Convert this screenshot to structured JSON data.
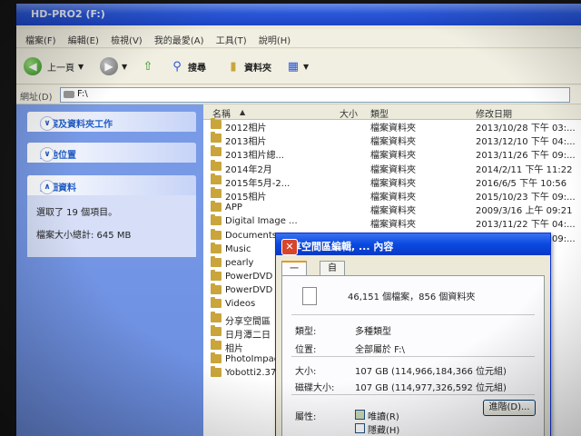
{
  "window": {
    "title": "HD-PRO2 (F:)"
  },
  "menu": [
    "檔案(F)",
    "編輯(E)",
    "檢視(V)",
    "我的最愛(A)",
    "工具(T)",
    "說明(H)"
  ],
  "toolbar": {
    "back": "上一頁",
    "search": "搜尋",
    "folders": "資料夾"
  },
  "address": {
    "label": "網址(D)",
    "value": "F:\\"
  },
  "left_panel": {
    "tasks_title": "檔案及資料夾工作",
    "places_title": "其他位置",
    "details_title": "詳細資料",
    "details_line1": "選取了 19 個項目。",
    "details_line2": "檔案大小總計: 645 MB"
  },
  "columns": {
    "name": "名稱",
    "size": "大小",
    "type": "類型",
    "date": "修改日期"
  },
  "files": [
    {
      "name": "2012相片",
      "type": "檔案資料夾",
      "date": "2013/10/28 下午 03:..."
    },
    {
      "name": "2013相片",
      "type": "檔案資料夾",
      "date": "2013/12/10 下午 04:..."
    },
    {
      "name": "2013相片總...",
      "type": "檔案資料夾",
      "date": "2013/11/26 下午 09:..."
    },
    {
      "name": "2014年2月",
      "type": "檔案資料夾",
      "date": "2014/2/11 下午 11:22"
    },
    {
      "name": "2015年5月-2...",
      "type": "檔案資料夾",
      "date": "2016/6/5 下午 10:56"
    },
    {
      "name": "2015相片",
      "type": "檔案資料夾",
      "date": "2015/10/23 下午 09:..."
    },
    {
      "name": "APP",
      "type": "檔案資料夾",
      "date": "2009/3/16 上午 09:21"
    },
    {
      "name": "Digital Image ...",
      "type": "檔案資料夾",
      "date": "2013/11/22 下午 04:..."
    },
    {
      "name": "Documents",
      "type": "檔案資料夾",
      "date": "2015/10/23 下午 09:..."
    },
    {
      "name": "Music",
      "type": "",
      "date": ""
    },
    {
      "name": "pearly",
      "type": "",
      "date": ""
    },
    {
      "name": "PowerDVD 8",
      "type": "",
      "date": ""
    },
    {
      "name": "PowerDVD 1",
      "type": "",
      "date": ""
    },
    {
      "name": "Videos",
      "type": "",
      "date": ""
    },
    {
      "name": "分享空間區",
      "type": "",
      "date": ""
    },
    {
      "name": "日月潭二日",
      "type": "",
      "date": ""
    },
    {
      "name": "相片",
      "type": "",
      "date": ""
    },
    {
      "name": "PhotoImpact",
      "type": "",
      "date": ""
    },
    {
      "name": "Yobotti2.37",
      "type": "",
      "date": ""
    }
  ],
  "dialog": {
    "title": "分享空間區編輯, ... 內容",
    "tab_general": "一般",
    "tab_custom": "自訂",
    "summary": "46,151 個檔案，856 個資料夾",
    "type_label": "類型:",
    "type_value": "多種類型",
    "location_label": "位置:",
    "location_value": "全部屬於 F:\\",
    "size_label": "大小:",
    "size_value": "107 GB (114,966,184,366 位元組)",
    "disk_label": "磁碟大小:",
    "disk_value": "107 GB (114,977,326,592 位元組)",
    "attr_label": "屬性:",
    "attr_readonly": "唯讀(R)",
    "attr_hidden": "隱藏(H)",
    "advanced_button": "進階(D)..."
  }
}
